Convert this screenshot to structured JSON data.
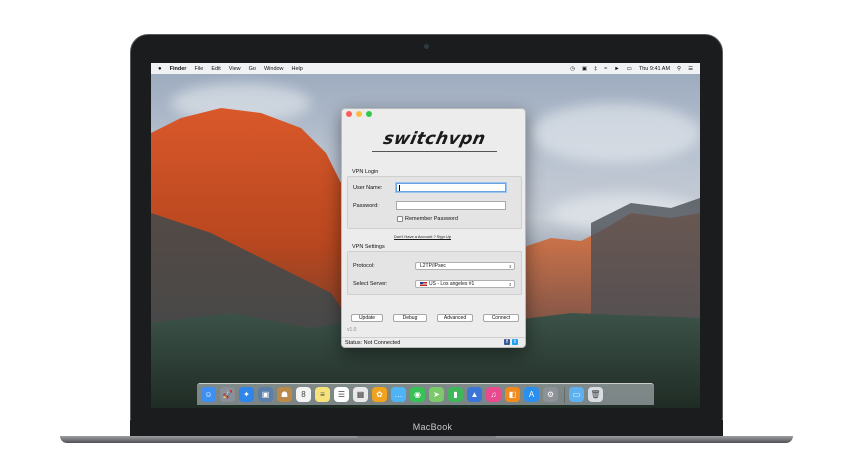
{
  "device": {
    "label": "MacBook"
  },
  "menubar": {
    "apple": "",
    "items": [
      "Finder",
      "File",
      "Edit",
      "View",
      "Go",
      "Window",
      "Help"
    ],
    "clock": "Thu 9:41 AM"
  },
  "app": {
    "logo_text": "switchvpn",
    "login_section": "VPN Login",
    "username_label": "User Name:",
    "password_label": "Password:",
    "remember_label": "Remember Password",
    "signup_link": "Don't Have a Account ? Sign Up",
    "settings_section": "VPN Settings",
    "protocol_label": "Protocol:",
    "protocol_value": "L2TP/IPsec",
    "server_label": "Select Server:",
    "server_value": "US - Los angeles #1",
    "buttons": {
      "update": "Update",
      "debug": "Debug",
      "advanced": "Advanced",
      "connect": "Connect"
    },
    "version": "v1.0",
    "status": "Status: Not Connected",
    "colors": {
      "close": "#fc605c",
      "minimize": "#fdbc40",
      "zoom": "#34c84a",
      "facebook": "#3b5998",
      "twitter": "#1da1f2"
    }
  },
  "dock": {
    "apps": [
      {
        "name": "finder-icon",
        "color": "#3d8ff2",
        "glyph": "☺"
      },
      {
        "name": "launchpad-icon",
        "color": "#8a8f98",
        "glyph": "🚀"
      },
      {
        "name": "safari-icon",
        "color": "#2f86e8",
        "glyph": "✦"
      },
      {
        "name": "photo-browser-icon",
        "color": "#5a7fa8",
        "glyph": "▣"
      },
      {
        "name": "contacts-icon",
        "color": "#b98a4a",
        "glyph": "☗"
      },
      {
        "name": "calendar-icon",
        "color": "#f4f4f4",
        "glyph": "8"
      },
      {
        "name": "notes-icon",
        "color": "#f5e27a",
        "glyph": "≡"
      },
      {
        "name": "reminders-icon",
        "color": "#ffffff",
        "glyph": "☰"
      },
      {
        "name": "photos-grid-icon",
        "color": "#e9e9e9",
        "glyph": "▦"
      },
      {
        "name": "photos-icon",
        "color": "#f0a21e",
        "glyph": "✿"
      },
      {
        "name": "messages-icon",
        "color": "#4fb4f5",
        "glyph": "…"
      },
      {
        "name": "facetime-icon",
        "color": "#38c157",
        "glyph": "◉"
      },
      {
        "name": "maps-icon",
        "color": "#7cc96a",
        "glyph": "➤"
      },
      {
        "name": "numbers-icon",
        "color": "#3fb65a",
        "glyph": "▮"
      },
      {
        "name": "keynote-icon",
        "color": "#3a76d8",
        "glyph": "▲"
      },
      {
        "name": "itunes-icon",
        "color": "#e94a8f",
        "glyph": "♫"
      },
      {
        "name": "ibooks-icon",
        "color": "#f08a1c",
        "glyph": "◧"
      },
      {
        "name": "app-store-icon",
        "color": "#2b8ff0",
        "glyph": "A"
      },
      {
        "name": "system-preferences-icon",
        "color": "#8d9198",
        "glyph": "⚙"
      }
    ],
    "extras": [
      {
        "name": "downloads-folder-icon",
        "color": "#5fb0ee",
        "glyph": "▭"
      },
      {
        "name": "trash-icon",
        "color": "#d8dde3",
        "glyph": "🗑"
      }
    ]
  }
}
